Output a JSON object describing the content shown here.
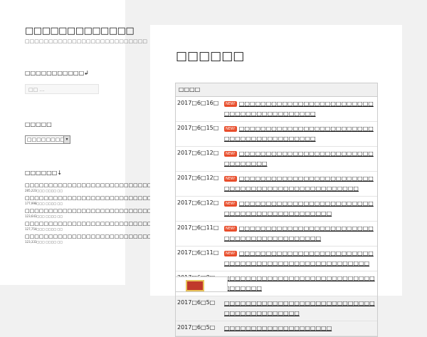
{
  "site": {
    "title": "□□□□□□□□□□□□□",
    "description": "□□□□□□□□□□□□□□□□□□□□□□□□□□"
  },
  "sidebar": {
    "widget1_title": "□□□□□□□□□□□↲",
    "search_placeholder": "□□ …",
    "widget2_title": "□□□□□",
    "select_value": "□□□□□□□□",
    "widget3_title": "□□□□□□↓",
    "ranking": [
      {
        "title": "□□□□□□□□□□□□□□□□□□□□□□□□□□□□□□□□□□□□",
        "meta": "285,223□□□ □□□□ □□"
      },
      {
        "title": "□□□□□□□□□□□□□□□□□□□□□□□□□□□",
        "meta": "177,998□□□ □□□□ □□"
      },
      {
        "title": "□□□□□□□□□□□□□□□□□□□□□□□□□□□□□□",
        "meta": "123,643□□□ □□□□ □□"
      },
      {
        "title": "□□□□□□□□□□□□□□□□□□□□□□□□□□□□□□□□",
        "meta": "127,754□□□ □□□□ □□"
      },
      {
        "title": "□□□□□□□□□□□□□□□□□□□□□□□□□□□□□□□□□",
        "meta": "123,333□□□ □□□□ □□"
      }
    ]
  },
  "main": {
    "page_title": "□□□□□□",
    "table_header": "□□□□",
    "new_label": "NEW!",
    "news": [
      {
        "date": "2017□6□16□",
        "new": true,
        "text": "□□□□□□□□□□□□□□□□□□□□□□□□□□□□□□□□□□□□□□□□□□"
      },
      {
        "date": "2017□6□15□",
        "new": true,
        "text": "□□□□□□□□□□□□□□□□□□□□□□□□□□□□□□□□□□□□□□□□□□"
      },
      {
        "date": "2017□6□12□",
        "new": true,
        "text": "□□□□□□□□□□□□□□□□□□□□□□□□□□□□□□□□□"
      },
      {
        "date": "2017□6□12□",
        "new": true,
        "text": "□□□□□□□□□□□□□□□□□□□□□□□□□□□□□□□□□□□□□□□□□□□□□□□□□□"
      },
      {
        "date": "2017□6□12□",
        "new": true,
        "text": "□□□□□□□□□□□□□□□□□□□□□□□□□□□□□□□□□□□□□□□□□□□□□"
      },
      {
        "date": "2017□6□11□",
        "new": true,
        "text": "□□□□□□□□□□□□□□□□□□□□□□□□□□□□□□□□□□□□□□□□□□□"
      },
      {
        "date": "2017□6□11□",
        "new": true,
        "text": "□□□□□□□□□□□□□□□□□□□□□□□□□□□□□□□□□□□□□□□□□□□□□□□□□□□□"
      },
      {
        "date": "2017□6□8□",
        "new": false,
        "text": "□□□□□□□□□□□□□□□□□□□□□□□□□□□□□□□□□□□"
      },
      {
        "date": "2017□6□5□",
        "new": false,
        "text": "□□□□□□□□□□□□□□□□□□□□□□□□□□□□□□□□□□□□□□□□□□"
      },
      {
        "date": "2017□6□5□",
        "new": false,
        "text": "□□□□□□□□□□□□□□□□□□□□"
      }
    ]
  }
}
